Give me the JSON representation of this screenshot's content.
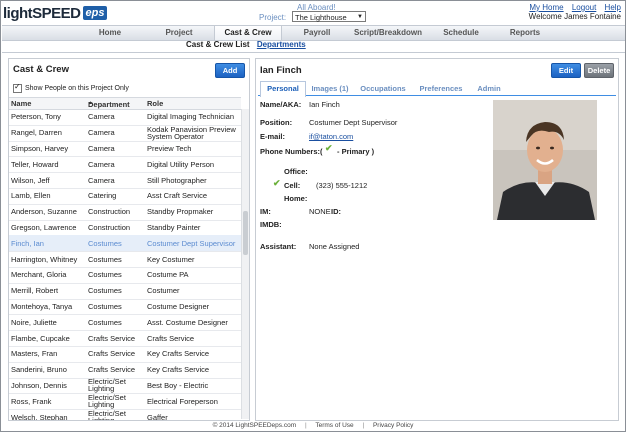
{
  "header": {
    "logo_main": "lightSPEED",
    "logo_badge": "eps",
    "all_aboard": "All Aboard!",
    "project_label": "Project:",
    "project_value": "The Lighthouse",
    "links": [
      "My Home",
      "Logout",
      "Help"
    ],
    "welcome": "Welcome  James Fontaine"
  },
  "nav": {
    "items": [
      "Home",
      "Project",
      "Cast & Crew",
      "Payroll",
      "Script/Breakdown",
      "Schedule",
      "Reports"
    ],
    "active": "Cast & Crew"
  },
  "subnav": {
    "current": "Cast & Crew List",
    "link": "Departments"
  },
  "left": {
    "title": "Cast & Crew",
    "add_label": "Add",
    "show_only": "Show People on this Project Only",
    "columns": {
      "name": "Name",
      "department": "Department",
      "role": "Role",
      "sort_indicator": "▲"
    },
    "rows": [
      {
        "name": "Peterson, Tony",
        "department": "Camera",
        "role": "Digital Imaging Technician"
      },
      {
        "name": "Rangel, Darren",
        "department": "Camera",
        "role": "Kodak Panavision Preview System Operator"
      },
      {
        "name": "Simpson, Harvey",
        "department": "Camera",
        "role": "Preview Tech"
      },
      {
        "name": "Teller, Howard",
        "department": "Camera",
        "role": "Digital Utility Person"
      },
      {
        "name": "Wilson, Jeff",
        "department": "Camera",
        "role": "Still Photographer"
      },
      {
        "name": "Lamb, Ellen",
        "department": "Catering",
        "role": "Asst Craft Service"
      },
      {
        "name": "Anderson, Suzanne",
        "department": "Construction",
        "role": "Standby Propmaker"
      },
      {
        "name": "Gregson, Lawrence",
        "department": "Construction",
        "role": "Standby Painter"
      },
      {
        "name": "Finch, Ian",
        "department": "Costumes",
        "role": "Costumer Dept Supervisor"
      },
      {
        "name": "Harrington, Whitney",
        "department": "Costumes",
        "role": "Key Costumer"
      },
      {
        "name": "Merchant, Gloria",
        "department": "Costumes",
        "role": "Costume PA"
      },
      {
        "name": "Merrill, Robert",
        "department": "Costumes",
        "role": "Costumer"
      },
      {
        "name": "Montehoya, Tanya",
        "department": "Costumes",
        "role": "Costume Designer"
      },
      {
        "name": "Noire, Juliette",
        "department": "Costumes",
        "role": "Asst. Costume Designer"
      },
      {
        "name": "Flambe, Cupcake",
        "department": "Crafts Service",
        "role": "Crafts Service"
      },
      {
        "name": "Masters, Fran",
        "department": "Crafts Service",
        "role": "Key Crafts Service"
      },
      {
        "name": "Sanderini, Bruno",
        "department": "Crafts Service",
        "role": "Key Crafts Service"
      },
      {
        "name": "Johnson, Dennis",
        "department": "Electric/Set Lighting",
        "role": "Best Boy - Electric"
      },
      {
        "name": "Ross, Frank",
        "department": "Electric/Set Lighting",
        "role": "Electrical Foreperson"
      },
      {
        "name": "Welsch, Stephan",
        "department": "Electric/Set Lighting",
        "role": "Gaffer"
      }
    ],
    "selected_index": 8
  },
  "right": {
    "name": "Ian Finch",
    "edit_label": "Edit",
    "delete_label": "Delete",
    "tabs": [
      "Personal",
      "Images (1)",
      "Occupations",
      "Preferences",
      "Admin"
    ],
    "active_tab": "Personal",
    "fields": {
      "name_aka_label": "Name/AKA:",
      "name_aka": "Ian Finch",
      "position_label": "Position:",
      "position": "Costumer Dept Supervisor",
      "email_label": "E-mail:",
      "email": "if@taton.com",
      "phone_label": "Phone Numbers:",
      "phone_paren_open": "(",
      "primary": "- Primary )",
      "office_label": "Office:",
      "cell_label": "Cell:",
      "cell": "(323) 555-1212",
      "home_label": "Home:",
      "im_label": "IM:",
      "im_value": "NONE",
      "id_label": "ID:",
      "imdb_label": "IMDB:",
      "assistant_label": "Assistant:",
      "assistant": "None Assigned"
    }
  },
  "footer": {
    "copyright": "© 2014 LightSPEEDeps.com",
    "separator": "|",
    "terms": "Terms of Use",
    "privacy": "Privacy Policy"
  },
  "colors": {
    "accent": "#1c62c2",
    "selected_row": "#e6eef9",
    "check": "#6bb03a"
  }
}
